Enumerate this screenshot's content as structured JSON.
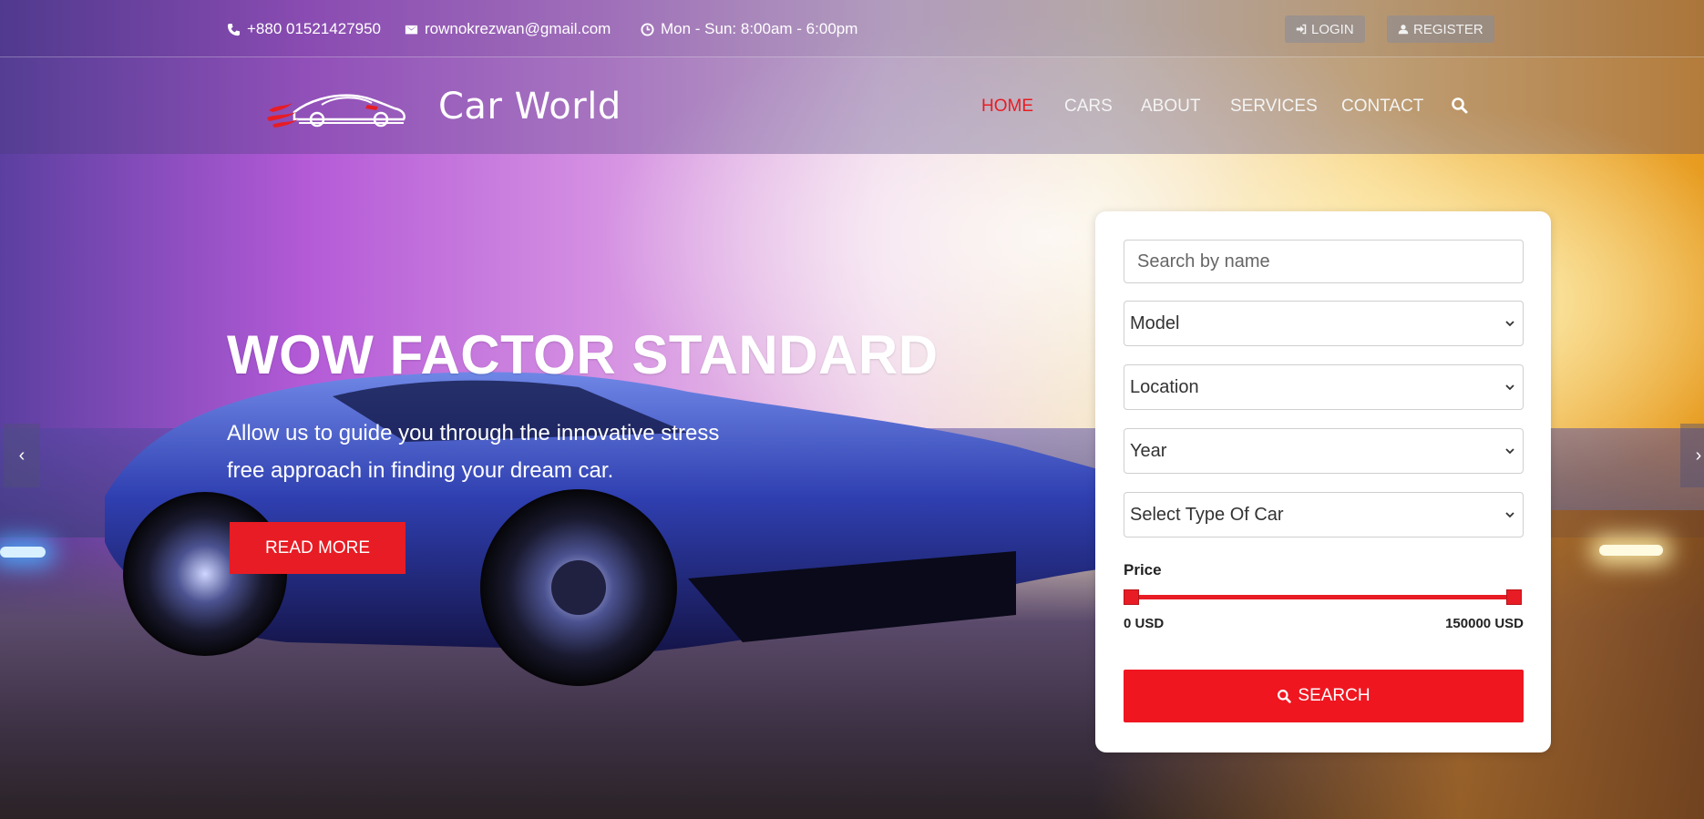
{
  "topbar": {
    "phone": "+880 01521427950",
    "email": "rownokrezwan@gmail.com",
    "hours": "Mon - Sun: 8:00am - 6:00pm",
    "login_label": "LOGIN",
    "register_label": "REGISTER"
  },
  "brand": {
    "name": "Car World"
  },
  "nav": {
    "items": [
      {
        "label": "HOME",
        "active": true
      },
      {
        "label": "CARS"
      },
      {
        "label": "ABOUT"
      },
      {
        "label": "SERVICES"
      },
      {
        "label": "CONTACT"
      }
    ]
  },
  "hero": {
    "title": "WOW FACTOR STANDARD",
    "subtitle": "Allow us to guide you through the innovative stress free approach in finding your dream car.",
    "button_label": "READ MORE"
  },
  "search_panel": {
    "name_placeholder": "Search by name",
    "model_label": "Model",
    "location_label": "Location",
    "year_label": "Year",
    "type_label": "Select Type Of Car",
    "price_label": "Price",
    "price_min": "0 USD",
    "price_max": "150000 USD",
    "price_range": {
      "min": 0,
      "max": 150000,
      "selected_min": 0,
      "selected_max": 150000
    },
    "search_label": "SEARCH"
  },
  "colors": {
    "accent": "#e81c24"
  }
}
